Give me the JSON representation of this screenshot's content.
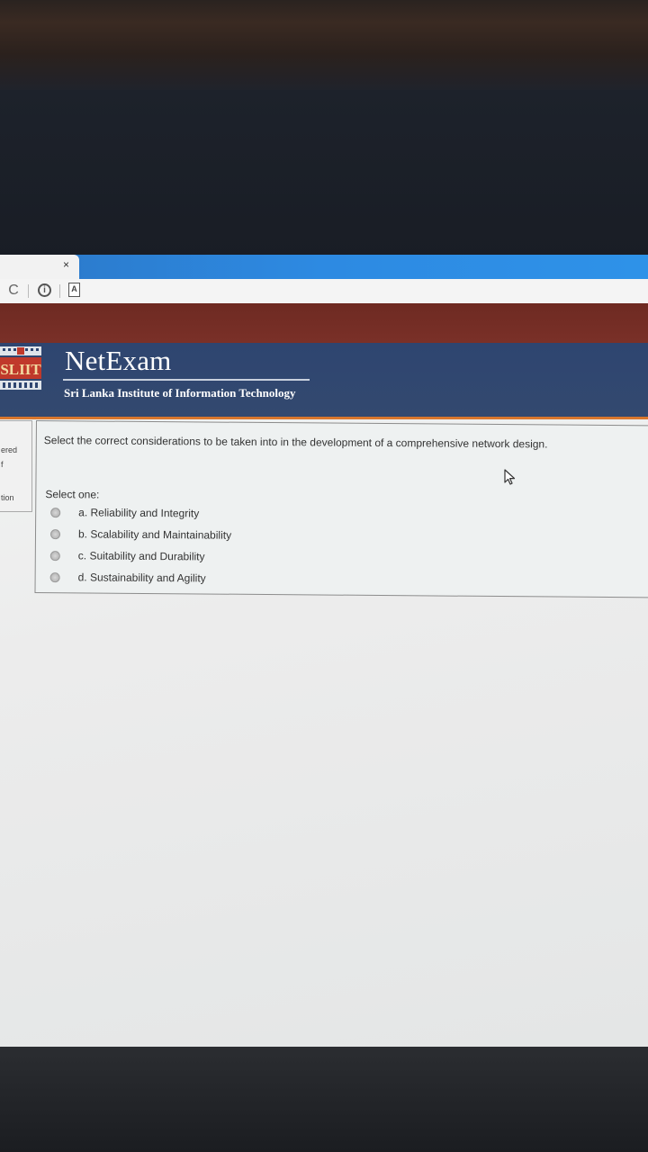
{
  "browser": {
    "tab_close": "×",
    "icons": [
      "reload-icon",
      "info-icon",
      "page-icon"
    ],
    "page_icon_glyph": "A",
    "info_icon_glyph": "i",
    "reload_icon_glyph": "C"
  },
  "header": {
    "brand": "NetExam",
    "institute": "Sri Lanka Institute of Information Technology",
    "logo_text": "SLIIT",
    "colors": {
      "navy": "#2e4570",
      "accent": "#d9772d",
      "maroon": "#6e2a22"
    }
  },
  "left_panel": {
    "line1": "ered",
    "line2": "f",
    "line3": "tion"
  },
  "question": {
    "text": "Select the correct considerations to be taken into in the development of a comprehensive network design.",
    "select_one_label": "Select one:",
    "options": [
      {
        "label": "a. Reliability and Integrity"
      },
      {
        "label": "b. Scalability and Maintainability"
      },
      {
        "label": "c. Suitability and Durability"
      },
      {
        "label": "d. Sustainability and Agility"
      }
    ]
  }
}
